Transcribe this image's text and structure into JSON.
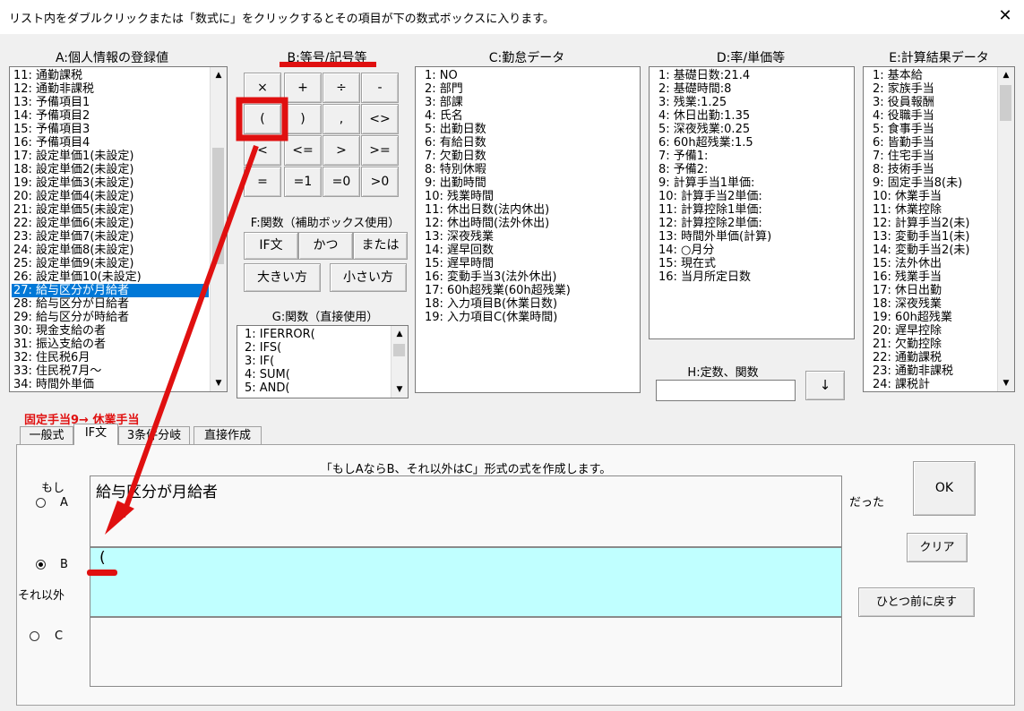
{
  "window": {
    "title": "リスト内をダブルクリックまたは「数式に」をクリックするとその項目が下の数式ボックスに入ります。",
    "close_glyph": "✕"
  },
  "sections": {
    "a": "A:個人情報の登録値",
    "b": "B:等号/記号等",
    "c": "C:勤怠データ",
    "d": "D:率/単価等",
    "e": "E:計算結果データ",
    "f": "F:関数（補助ボックス使用）",
    "g": "G:関数（直接使用）",
    "h": "H:定数、関数"
  },
  "list_a": [
    "11: 通勤課税",
    "12: 通勤非課税",
    "13: 予備項目1",
    "14: 予備項目2",
    "15: 予備項目3",
    "16: 予備項目4",
    "17: 設定単価1(未設定)",
    "18: 設定単価2(未設定)",
    "19: 設定単価3(未設定)",
    "20: 設定単価4(未設定)",
    "21: 設定単価5(未設定)",
    "22: 設定単価6(未設定)",
    "23: 設定単価7(未設定)",
    "24: 設定単価8(未設定)",
    "25: 設定単価9(未設定)",
    "26: 設定単価10(未設定)",
    "27: 給与区分が月給者",
    "28: 給与区分が日給者",
    "29: 給与区分が時給者",
    "30: 現金支給の者",
    "31: 振込支給の者",
    "32: 住民税6月",
    "33: 住民税7月～",
    "34: 時間外単価"
  ],
  "list_a_selected_index": 16,
  "buttons_b": [
    [
      "×",
      "+",
      "÷",
      "-"
    ],
    [
      "(",
      ")",
      ",",
      "<>"
    ],
    [
      "<",
      "<=",
      ">",
      ">="
    ],
    [
      "=",
      "=1",
      "=0",
      ">0"
    ]
  ],
  "buttons_f": [
    "IF文",
    "かつ",
    "または",
    "大きい方",
    "小さい方"
  ],
  "list_g": [
    "1: IFERROR(",
    "2: IFS(",
    "3: IF(",
    "4: SUM(",
    "5: AND("
  ],
  "list_c": [
    "1: NO",
    "2: 部門",
    "3: 部課",
    "4: 氏名",
    "5: 出勤日数",
    "6: 有給日数",
    "7: 欠勤日数",
    "8: 特別休暇",
    "9: 出勤時間",
    "10: 残業時間",
    "11: 休出日数(法内休出)",
    "12: 休出時間(法外休出)",
    "13: 深夜残業",
    "14: 遅早回数",
    "15: 遅早時間",
    "16: 変動手当3(法外休出)",
    "17: 60h超残業(60h超残業)",
    "18: 入力項目B(休業日数)",
    "19: 入力項目C(休業時間)"
  ],
  "list_d": [
    "1: 基礎日数:21.4",
    "2: 基礎時間:8",
    "3: 残業:1.25",
    "4: 休日出勤:1.35",
    "5: 深夜残業:0.25",
    "6: 60h超残業:1.5",
    "7: 予備1:",
    "8: 予備2:",
    "9: 計算手当1単価:",
    "10: 計算手当2単価:",
    "11: 計算控除1単価:",
    "12: 計算控除2単価:",
    "13: 時間外単価(計算)",
    "14: ○月分",
    "15: 現在式",
    "16: 当月所定日数"
  ],
  "list_e": [
    "1: 基本給",
    "2: 家族手当",
    "3: 役員報酬",
    "4: 役職手当",
    "5: 食事手当",
    "6: 皆勤手当",
    "7: 住宅手当",
    "8: 技術手当",
    "9: 固定手当8(未)",
    "10: 休業手当",
    "11: 休業控除",
    "12: 計算手当2(未)",
    "13: 変動手当1(未)",
    "14: 変動手当2(未)",
    "15: 法外休出",
    "16: 残業手当",
    "17: 休日出勤",
    "18: 深夜残業",
    "19: 60h超残業",
    "20: 遅早控除",
    "21: 欠勤控除",
    "22: 通勤課税",
    "23: 通勤非課税",
    "24: 課税計"
  ],
  "h_input_value": "",
  "h_down_button": "↓",
  "annotation": "固定手当9→ 休業手当",
  "tabs": [
    "一般式",
    "IF文",
    "3条件分岐",
    "直接作成"
  ],
  "active_tab": 1,
  "if_panel": {
    "description": "「もしAならB、それ以外はC」形式の式を作成します。",
    "moshi": "もし",
    "radio_a": "A",
    "radio_b": "B",
    "radio_c": "C",
    "sorei_gai": "それ以外",
    "datta": "だった",
    "box_a_value": "給与区分が月給者",
    "box_b_value": "(",
    "box_c_value": "",
    "selected_radio": "B"
  },
  "action_buttons": {
    "ok": "OK",
    "clear": "クリア",
    "undo": "ひとつ前に戻す"
  },
  "colors": {
    "selection": "#0078d7",
    "highlight_box": "#c0ffff",
    "annotation_red": "#e01010"
  }
}
